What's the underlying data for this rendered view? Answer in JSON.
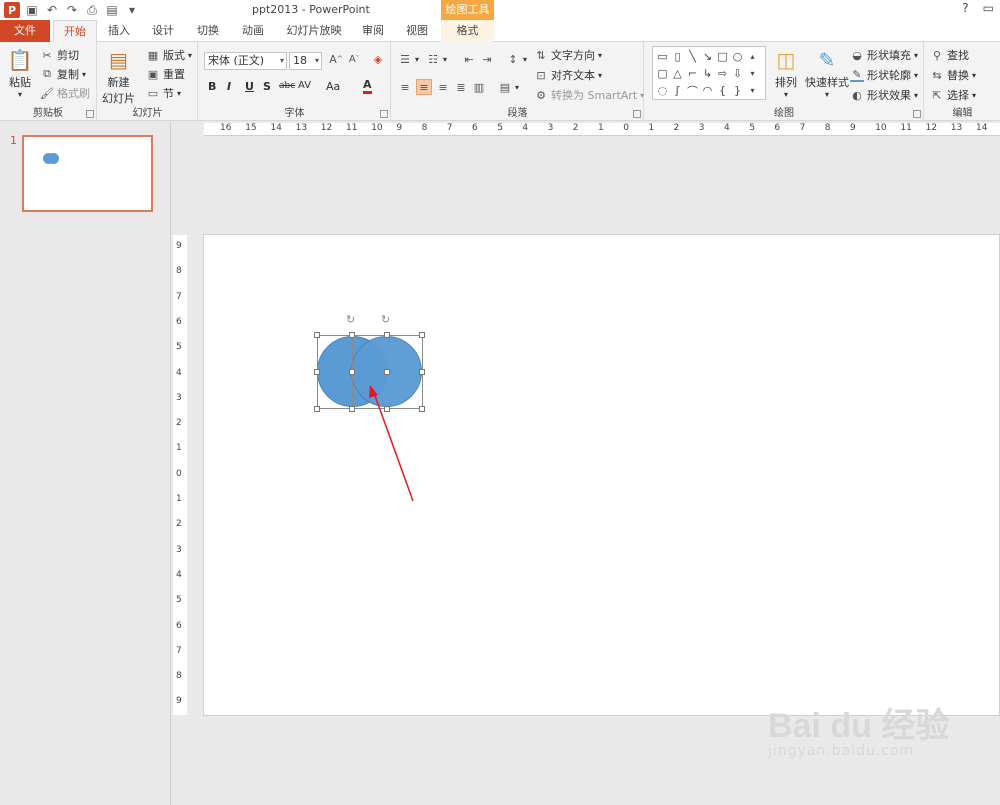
{
  "title": {
    "document": "ppt2013 - PowerPoint",
    "context_tab_header": "绘图工具",
    "help": "?"
  },
  "tabs": [
    {
      "label": "文件"
    },
    {
      "label": "开始"
    },
    {
      "label": "插入"
    },
    {
      "label": "设计"
    },
    {
      "label": "切换"
    },
    {
      "label": "动画"
    },
    {
      "label": "幻灯片放映"
    },
    {
      "label": "审阅"
    },
    {
      "label": "视图"
    },
    {
      "label": "格式"
    }
  ],
  "ribbon": {
    "clipboard": {
      "label": "剪贴板",
      "paste": "粘贴",
      "cut": "剪切",
      "copy": "复制",
      "format_painter": "格式刷"
    },
    "slides": {
      "label": "幻灯片",
      "new_slide_line1": "新建",
      "new_slide_line2": "幻灯片",
      "layout": "版式",
      "reset": "重置",
      "section": "节"
    },
    "font": {
      "label": "字体",
      "font_name": "宋体 (正文)",
      "font_size": "18",
      "bold": "B",
      "italic": "I",
      "underline": "U",
      "shadow": "S",
      "strike": "abc",
      "spacing": "AV",
      "case": "Aa",
      "color": "A"
    },
    "paragraph": {
      "label": "段落",
      "text_direction": "文字方向",
      "align_text": "对齐文本",
      "smartart": "转换为 SmartArt"
    },
    "drawing": {
      "label": "绘图",
      "arrange": "排列",
      "quick_styles": "快速样式",
      "shape_fill": "形状填充",
      "shape_outline": "形状轮廓",
      "shape_effects": "形状效果"
    },
    "editing": {
      "label": "编辑",
      "find": "查找",
      "replace": "替换",
      "select": "选择"
    }
  },
  "slide_panel": {
    "slide_number": "1"
  },
  "ruler": {
    "horizontal": [
      "16",
      "15",
      "14",
      "13",
      "12",
      "11",
      "10",
      "9",
      "8",
      "7",
      "6",
      "5",
      "4",
      "3",
      "2",
      "1",
      "0",
      "1",
      "2",
      "3",
      "4",
      "5",
      "6",
      "7",
      "8",
      "9",
      "10",
      "11",
      "12",
      "13",
      "14"
    ],
    "vertical": [
      "9",
      "8",
      "7",
      "6",
      "5",
      "4",
      "3",
      "2",
      "1",
      "0",
      "1",
      "2",
      "3",
      "4",
      "5",
      "6",
      "7",
      "8",
      "9"
    ]
  },
  "colors": {
    "accent": "#d24726",
    "shape_fill": "#5b9bd5",
    "arrow": "#e8191b",
    "context": "#f4a742"
  },
  "watermark": {
    "top": "Bai du 经验",
    "bottom": "jingyan.baidu.com"
  }
}
